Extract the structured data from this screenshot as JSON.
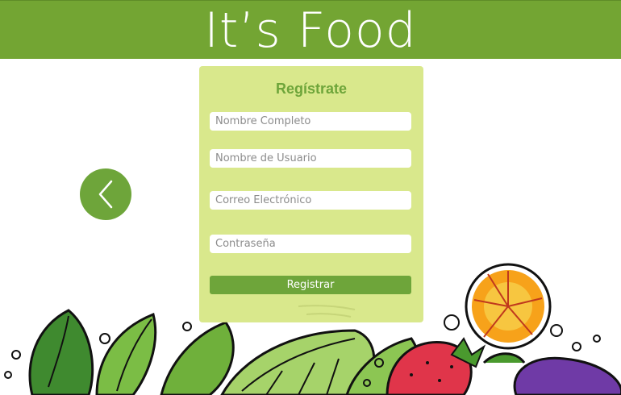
{
  "header": {
    "title": "It’s Food"
  },
  "form": {
    "title": "Regístrate",
    "fields": [
      {
        "placeholder": "Nombre Completo"
      },
      {
        "placeholder": "Nombre de Usuario"
      },
      {
        "placeholder": "Correo Electrónico"
      },
      {
        "placeholder": "Contraseña"
      }
    ],
    "submit_label": "Registrar"
  },
  "navigation": {
    "back_icon": "chevron-left-icon"
  },
  "colors": {
    "brand_green": "#73a533",
    "button_green": "#6ea53a",
    "card_background": "#d6e682"
  }
}
